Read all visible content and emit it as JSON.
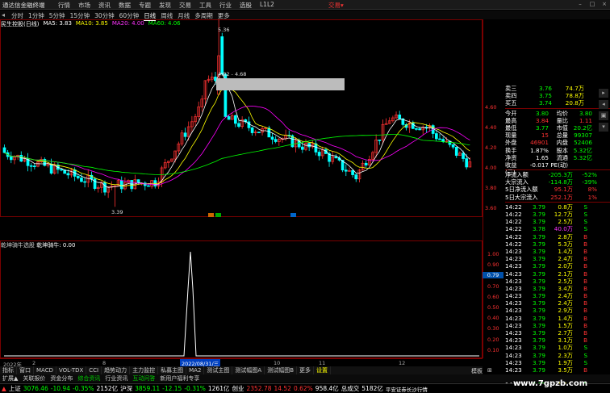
{
  "topbar": {
    "logo": "通达信金融终端",
    "menu": [
      "行情",
      "市场",
      "资讯",
      "数据",
      "专题",
      "发现",
      "交易",
      "工具",
      "行业",
      "选股",
      "L1L2"
    ],
    "brand": "交易▾"
  },
  "periods": [
    "分时",
    "1分钟",
    "5分钟",
    "15分钟",
    "30分钟",
    "60分钟",
    "日线",
    "周线",
    "月线",
    "多周期",
    "更多"
  ],
  "period_active": "日线",
  "indicator_header": {
    "name": "民生控股(日线)",
    "ma5": "MA5: 3.83",
    "ma10": "MA10: 3.85",
    "ma20": "MA20: 4.00",
    "ma60": "MA60: 4.06"
  },
  "price_labels": {
    "high": "5.36",
    "low": "3.39",
    "band": "4.82 - 4.68"
  },
  "axis_main": [
    "4.60",
    "4.40",
    "4.20",
    "4.00",
    "3.80",
    "3.60"
  ],
  "axis_sub": [
    "1.00",
    "0.90",
    "0.80",
    "0.70",
    "0.60",
    "0.50",
    "0.40",
    "0.30",
    "0.20",
    "0.10"
  ],
  "sub_value_box": "0.79",
  "sub_header": {
    "name": "乾坤骑牛选股",
    "value": "乾坤骑牛: 0.00"
  },
  "dates": [
    "2022年",
    "2",
    "8",
    "10",
    "11",
    "12"
  ],
  "date_highlight": "2022/08/31/三",
  "tabs": [
    "指标",
    "窗口",
    "MACD",
    "VOL-TDX",
    "CCI",
    "趋势动力",
    "主力监控",
    "私募主图",
    "MA2",
    "测试主图",
    "测试幅图A",
    "测试幅图B",
    "更多",
    "设置"
  ],
  "tab_selected": "设置",
  "right_edge": [
    "模板",
    "⊞"
  ],
  "bottom_tabs": [
    "扩展▲",
    "关联报价",
    "资金分布",
    "综合资讯",
    "行业资讯",
    "互动问答",
    "新用户福利专享"
  ],
  "quote": {
    "asks": [
      [
        "卖三",
        "3.76",
        "74.7万"
      ],
      [
        "卖四",
        "3.75",
        "78.8万"
      ],
      [
        "买五",
        "3.74",
        "20.8万"
      ]
    ],
    "stats": [
      [
        "今开",
        "3.80",
        "均价",
        "3.80"
      ],
      [
        "最高",
        "3.84",
        "量比",
        "1.11"
      ],
      [
        "最低",
        "3.77",
        "市值",
        "20.2亿"
      ],
      [
        "现量",
        "15",
        "总量",
        "99307"
      ],
      [
        "外盘",
        "46901",
        "内盘",
        "52406"
      ],
      [
        "换手",
        "1.87%",
        "股本",
        "5.32亿"
      ],
      [
        "净资",
        "1.65",
        "流通",
        "5.32亿"
      ],
      [
        "收益(三)",
        "-0.017",
        "PE(动)",
        ""
      ]
    ],
    "flows": [
      [
        "净流入额",
        "-205.3万",
        "-52%"
      ],
      [
        "大宗流入",
        "-114.8万",
        "-39%"
      ],
      [
        "5日净流入额",
        "95.1万",
        "8%"
      ],
      [
        "5日大宗流入",
        "252.1万",
        "1%"
      ]
    ],
    "ticks": [
      [
        "14:22",
        "3.79",
        "0.8万",
        "S"
      ],
      [
        "14:22",
        "3.79",
        "12.7万",
        "S"
      ],
      [
        "14:22",
        "3.79",
        "2.5万",
        "S"
      ],
      [
        "14:22",
        "3.78",
        "40.0万",
        "S"
      ],
      [
        "14:22",
        "3.79",
        "2.8万",
        "B"
      ],
      [
        "14:22",
        "3.79",
        "5.3万",
        "B"
      ],
      [
        "14:23",
        "3.79",
        "1.4万",
        "B"
      ],
      [
        "14:23",
        "3.79",
        "2.4万",
        "B"
      ],
      [
        "14:23",
        "3.79",
        "2.0万",
        "B"
      ],
      [
        "14:23",
        "3.79",
        "2.1万",
        "B"
      ],
      [
        "14:23",
        "3.79",
        "2.5万",
        "B"
      ],
      [
        "14:23",
        "3.79",
        "3.4万",
        "B"
      ],
      [
        "14:23",
        "3.79",
        "2.4万",
        "B"
      ],
      [
        "14:23",
        "3.79",
        "2.4万",
        "B"
      ],
      [
        "14:23",
        "3.79",
        "2.9万",
        "B"
      ],
      [
        "14:23",
        "3.79",
        "1.4万",
        "B"
      ],
      [
        "14:23",
        "3.79",
        "1.5万",
        "B"
      ],
      [
        "14:23",
        "3.79",
        "2.7万",
        "B"
      ],
      [
        "14:23",
        "3.79",
        "3.1万",
        "B"
      ],
      [
        "14:23",
        "3.79",
        "1.0万",
        "S"
      ],
      [
        "14:23",
        "3.79",
        "2.3万",
        "S"
      ],
      [
        "14:23",
        "3.79",
        "1.9万",
        "S"
      ],
      [
        "14:23",
        "3.79",
        "3.5万",
        "B"
      ],
      [
        "14:23",
        "3.79",
        "2.1万",
        "S"
      ],
      [
        "14:23",
        "3.79",
        "1.5万",
        "S"
      ],
      [
        "14:23",
        "3.79",
        "2.3万",
        "B"
      ]
    ]
  },
  "status": {
    "sh_label": "上证",
    "sh_val": "3076.46",
    "sh_chg": "-10.94",
    "sh_pct": "-0.35%",
    "sh_amt": "2152亿",
    "sz_label": "沪深",
    "sz_val": "3859.11",
    "sz_chg": "-12.15",
    "sz_pct": "-0.31%",
    "sz_amt": "1261亿",
    "cy_label": "创业",
    "cy_val": "2352.78",
    "cy_chg": "14.52",
    "cy_pct": "0.62%",
    "cy_amt": "958.4亿",
    "total_label": "总成交",
    "total_amt": "5182亿",
    "broker": "平安证券长沙行情"
  },
  "watermark": "www.7gpzb.com",
  "colors": {
    "up": "#ff3232",
    "down": "#00ffff",
    "ma5": "#ffffff",
    "ma10": "#ffff00",
    "ma20": "#ff00ff",
    "ma60": "#00ff00",
    "frame": "#7a0000"
  }
}
